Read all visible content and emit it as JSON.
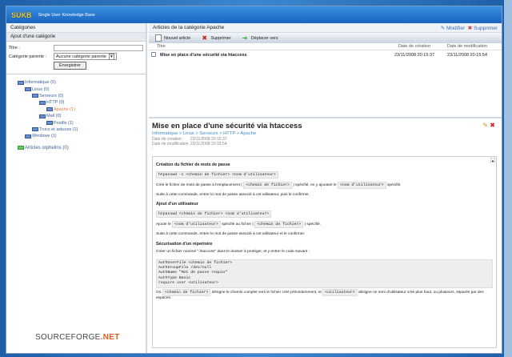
{
  "app": {
    "logo": "SUKB",
    "subtitle": "Single User Knowledge Base"
  },
  "left": {
    "title": "Catégories",
    "add_section": "Ajout d'une catégorie",
    "title_label": "Titre :",
    "title_value": "",
    "parent_label": "Catégorie parente :",
    "parent_value": "Aucune catégorie parente",
    "save": "Enregistrer",
    "tree": [
      {
        "label": "Informatique (0)",
        "depth": 0
      },
      {
        "label": "Linux (0)",
        "depth": 1
      },
      {
        "label": "Serveurs (0)",
        "depth": 2
      },
      {
        "label": "HTTP (0)",
        "depth": 3
      },
      {
        "label": "Apache (1)",
        "depth": 4,
        "selected": true
      },
      {
        "label": "Mail (0)",
        "depth": 3
      },
      {
        "label": "Postfix (1)",
        "depth": 4
      },
      {
        "label": "Trucs et astuces (1)",
        "depth": 2
      },
      {
        "label": "Windows (1)",
        "depth": 1
      }
    ],
    "orphans": "Articles orphelins (0)",
    "sourceforge": "SOURCEFORGE",
    "sourceforge_tld": ".NET"
  },
  "right": {
    "title": "Articles de la catégorie Apache",
    "edit": "Modifier",
    "delete": "Supprimer",
    "toolbar": {
      "new": "Nouvel article",
      "delete": "Supprimer",
      "move": "Déplacer vers"
    },
    "columns": [
      "Titre",
      "Date de création",
      "Date de modification"
    ],
    "rows": [
      {
        "title": "Mise en place d'une sécurité via htaccess",
        "created": "23/11/2008 20:15:37",
        "modified": "23/11/2008 20:15:54"
      }
    ]
  },
  "article": {
    "title": "Mise en place d'une sécurité via htaccess",
    "breadcrumb": "Informatique > Linux > Serveurs > HTTP > Apache",
    "created_label": "Date de création :",
    "created": "23/11/2008 20:15:37",
    "modified_label": "Date de modification :",
    "modified": "23/11/2008 20:15:54",
    "h1": "Création du fichier de mots de passe",
    "cmd1": "htpasswd -c <chemin de fichier> <nom d'utilisateur>",
    "p1a": "Créé le fichier de mots de passe à l'emplacement (",
    "code_path": "<chemin de fichier>",
    "p1b": ") spécifié, en y ajoutant le",
    "code_user": "<nom d'utilisateur>",
    "p1c": "spécifié.",
    "p2": "Suite à cette commande, entrer le mot de passe associé à cet utilisateur, puis le confirmer.",
    "h2": "Ajout d'un utilisateur",
    "cmd2": "htpasswd <chemin de fichier> <nom d'utilisateur>",
    "p3a": "Ajoute le",
    "p3b": "spécifié au fichier (",
    "p3c": ") spécifié.",
    "p4": "Suite à cette commande, entrer le mot de passe associé à cet utilisateur et le confirmer.",
    "h3": "Sécurisation d'un répertoire",
    "p5": "Créer un fichier nommé \".htaccess\" dans le dossier à protéger, et y entrer le code suivant :",
    "code": "AuthUserFile <chemin de fichier>\nAuthGroupFile /dev/null\nAuthName \"Mot de passe requis\"\nAuthType Basic\nrequire user <utilisateur>",
    "p6a": "Où",
    "p6b": "désigne le chemin complet vers le fichier créé précédemment, et",
    "code_u2": "<utilisateur>",
    "p6c": "désigne un nom d'utilisateur créé plus haut, ou plusieurs, séparés par des espaces."
  }
}
